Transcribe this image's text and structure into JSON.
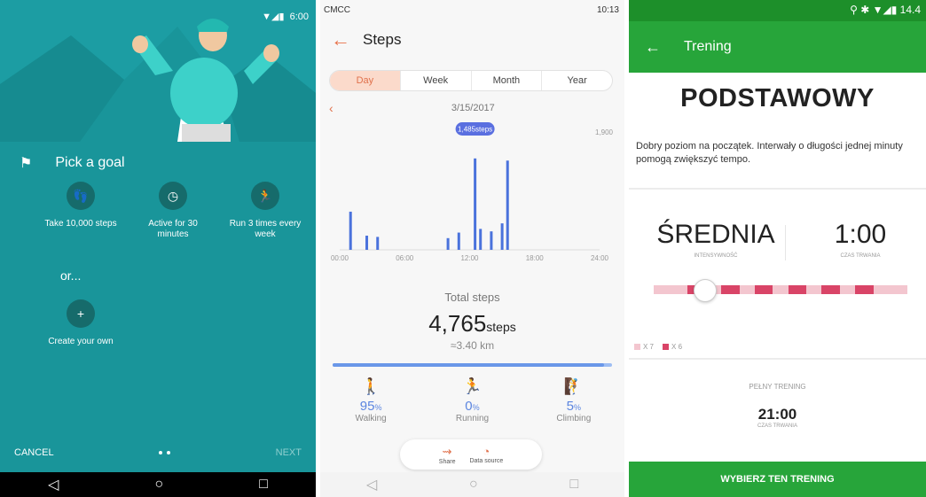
{
  "fit": {
    "status": {
      "time": "6:00"
    },
    "goal_title": "Pick a goal",
    "options": [
      {
        "label": "Take 10,000 steps",
        "icon": "footsteps-icon"
      },
      {
        "label": "Active for 30 minutes",
        "icon": "timer-icon"
      },
      {
        "label": "Run 3 times every week",
        "icon": "running-icon"
      }
    ],
    "or_text": "or...",
    "create_label": "Create your own",
    "cancel": "CANCEL",
    "next": "NEXT",
    "colors": {
      "bg": "#19959a",
      "circle": "#166b6b"
    }
  },
  "steps": {
    "status": {
      "carrier": "CMCC",
      "time": "10:13"
    },
    "title": "Steps",
    "tabs": [
      "Day",
      "Week",
      "Month",
      "Year"
    ],
    "active_tab": "Day",
    "date": "3/15/2017",
    "total_label": "Total steps",
    "total_value": "4,765",
    "total_unit": "steps",
    "distance": "≈3.40 km",
    "progress": 0.97,
    "activities": [
      {
        "label": "Walking",
        "value": "95",
        "unit": "%",
        "icon": "walking-icon"
      },
      {
        "label": "Running",
        "value": "0",
        "unit": "%",
        "icon": "running-icon"
      },
      {
        "label": "Climbing",
        "value": "5",
        "unit": "%",
        "icon": "climbing-icon"
      }
    ],
    "share_label": "Share",
    "source_label": "Data source",
    "colors": {
      "accent": "#e0714c",
      "bar": "#4a72dc",
      "highlight": "#5a6fe0"
    }
  },
  "chart_data": {
    "type": "bar",
    "x_ticks": [
      "00:00",
      "06:00",
      "12:00",
      "18:00",
      "24:00"
    ],
    "y_max_label": "1,900",
    "ylim": [
      0,
      1900
    ],
    "highlight": {
      "value": 1485,
      "label": "1,485steps"
    },
    "bars": [
      {
        "hour": 1,
        "value": 620
      },
      {
        "hour": 2.5,
        "value": 230
      },
      {
        "hour": 3.5,
        "value": 210
      },
      {
        "hour": 10,
        "value": 190
      },
      {
        "hour": 11,
        "value": 280
      },
      {
        "hour": 12.5,
        "value": 1485
      },
      {
        "hour": 13,
        "value": 340
      },
      {
        "hour": 14,
        "value": 300
      },
      {
        "hour": 15,
        "value": 430
      },
      {
        "hour": 15.5,
        "value": 1450
      }
    ]
  },
  "trening": {
    "status": {
      "time": "14.4"
    },
    "title": "Trening",
    "level": "PODSTAWOWY",
    "description": "Dobry poziom na początek. Interwały o długości jednej minuty pomogą zwiększyć tempo.",
    "intensity_value": "ŚREDNIA",
    "intensity_label": "INTENSYWNOŚĆ",
    "duration_value": "1:00",
    "duration_label": "CZAS TRWANIA",
    "legend": [
      {
        "label": "X 7",
        "color": "#f3c6cf"
      },
      {
        "label": "X 6",
        "color": "#d94467"
      }
    ],
    "full_label": "PEŁNY TRENING",
    "full_value": "21:00",
    "full_sub": "CZAS TRWANIA",
    "button": "WYBIERZ TEN TRENING",
    "colors": {
      "green": "#27a53a",
      "dark_green": "#1d8f2a"
    }
  }
}
